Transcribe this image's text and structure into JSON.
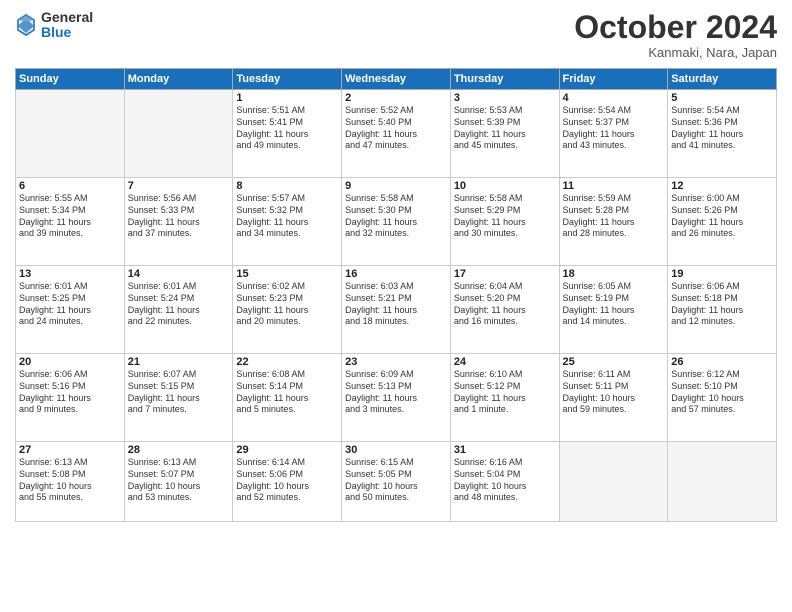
{
  "logo": {
    "general": "General",
    "blue": "Blue"
  },
  "title": "October 2024",
  "location": "Kanmaki, Nara, Japan",
  "weekdays": [
    "Sunday",
    "Monday",
    "Tuesday",
    "Wednesday",
    "Thursday",
    "Friday",
    "Saturday"
  ],
  "cells": [
    {
      "day": "",
      "empty": true
    },
    {
      "day": "",
      "empty": true
    },
    {
      "day": "1",
      "lines": [
        "Sunrise: 5:51 AM",
        "Sunset: 5:41 PM",
        "Daylight: 11 hours",
        "and 49 minutes."
      ]
    },
    {
      "day": "2",
      "lines": [
        "Sunrise: 5:52 AM",
        "Sunset: 5:40 PM",
        "Daylight: 11 hours",
        "and 47 minutes."
      ]
    },
    {
      "day": "3",
      "lines": [
        "Sunrise: 5:53 AM",
        "Sunset: 5:39 PM",
        "Daylight: 11 hours",
        "and 45 minutes."
      ]
    },
    {
      "day": "4",
      "lines": [
        "Sunrise: 5:54 AM",
        "Sunset: 5:37 PM",
        "Daylight: 11 hours",
        "and 43 minutes."
      ]
    },
    {
      "day": "5",
      "lines": [
        "Sunrise: 5:54 AM",
        "Sunset: 5:36 PM",
        "Daylight: 11 hours",
        "and 41 minutes."
      ]
    },
    {
      "day": "6",
      "lines": [
        "Sunrise: 5:55 AM",
        "Sunset: 5:34 PM",
        "Daylight: 11 hours",
        "and 39 minutes."
      ]
    },
    {
      "day": "7",
      "lines": [
        "Sunrise: 5:56 AM",
        "Sunset: 5:33 PM",
        "Daylight: 11 hours",
        "and 37 minutes."
      ]
    },
    {
      "day": "8",
      "lines": [
        "Sunrise: 5:57 AM",
        "Sunset: 5:32 PM",
        "Daylight: 11 hours",
        "and 34 minutes."
      ]
    },
    {
      "day": "9",
      "lines": [
        "Sunrise: 5:58 AM",
        "Sunset: 5:30 PM",
        "Daylight: 11 hours",
        "and 32 minutes."
      ]
    },
    {
      "day": "10",
      "lines": [
        "Sunrise: 5:58 AM",
        "Sunset: 5:29 PM",
        "Daylight: 11 hours",
        "and 30 minutes."
      ]
    },
    {
      "day": "11",
      "lines": [
        "Sunrise: 5:59 AM",
        "Sunset: 5:28 PM",
        "Daylight: 11 hours",
        "and 28 minutes."
      ]
    },
    {
      "day": "12",
      "lines": [
        "Sunrise: 6:00 AM",
        "Sunset: 5:26 PM",
        "Daylight: 11 hours",
        "and 26 minutes."
      ]
    },
    {
      "day": "13",
      "lines": [
        "Sunrise: 6:01 AM",
        "Sunset: 5:25 PM",
        "Daylight: 11 hours",
        "and 24 minutes."
      ]
    },
    {
      "day": "14",
      "lines": [
        "Sunrise: 6:01 AM",
        "Sunset: 5:24 PM",
        "Daylight: 11 hours",
        "and 22 minutes."
      ]
    },
    {
      "day": "15",
      "lines": [
        "Sunrise: 6:02 AM",
        "Sunset: 5:23 PM",
        "Daylight: 11 hours",
        "and 20 minutes."
      ]
    },
    {
      "day": "16",
      "lines": [
        "Sunrise: 6:03 AM",
        "Sunset: 5:21 PM",
        "Daylight: 11 hours",
        "and 18 minutes."
      ]
    },
    {
      "day": "17",
      "lines": [
        "Sunrise: 6:04 AM",
        "Sunset: 5:20 PM",
        "Daylight: 11 hours",
        "and 16 minutes."
      ]
    },
    {
      "day": "18",
      "lines": [
        "Sunrise: 6:05 AM",
        "Sunset: 5:19 PM",
        "Daylight: 11 hours",
        "and 14 minutes."
      ]
    },
    {
      "day": "19",
      "lines": [
        "Sunrise: 6:06 AM",
        "Sunset: 5:18 PM",
        "Daylight: 11 hours",
        "and 12 minutes."
      ]
    },
    {
      "day": "20",
      "lines": [
        "Sunrise: 6:06 AM",
        "Sunset: 5:16 PM",
        "Daylight: 11 hours",
        "and 9 minutes."
      ]
    },
    {
      "day": "21",
      "lines": [
        "Sunrise: 6:07 AM",
        "Sunset: 5:15 PM",
        "Daylight: 11 hours",
        "and 7 minutes."
      ]
    },
    {
      "day": "22",
      "lines": [
        "Sunrise: 6:08 AM",
        "Sunset: 5:14 PM",
        "Daylight: 11 hours",
        "and 5 minutes."
      ]
    },
    {
      "day": "23",
      "lines": [
        "Sunrise: 6:09 AM",
        "Sunset: 5:13 PM",
        "Daylight: 11 hours",
        "and 3 minutes."
      ]
    },
    {
      "day": "24",
      "lines": [
        "Sunrise: 6:10 AM",
        "Sunset: 5:12 PM",
        "Daylight: 11 hours",
        "and 1 minute."
      ]
    },
    {
      "day": "25",
      "lines": [
        "Sunrise: 6:11 AM",
        "Sunset: 5:11 PM",
        "Daylight: 10 hours",
        "and 59 minutes."
      ]
    },
    {
      "day": "26",
      "lines": [
        "Sunrise: 6:12 AM",
        "Sunset: 5:10 PM",
        "Daylight: 10 hours",
        "and 57 minutes."
      ]
    },
    {
      "day": "27",
      "lines": [
        "Sunrise: 6:13 AM",
        "Sunset: 5:08 PM",
        "Daylight: 10 hours",
        "and 55 minutes."
      ]
    },
    {
      "day": "28",
      "lines": [
        "Sunrise: 6:13 AM",
        "Sunset: 5:07 PM",
        "Daylight: 10 hours",
        "and 53 minutes."
      ]
    },
    {
      "day": "29",
      "lines": [
        "Sunrise: 6:14 AM",
        "Sunset: 5:06 PM",
        "Daylight: 10 hours",
        "and 52 minutes."
      ]
    },
    {
      "day": "30",
      "lines": [
        "Sunrise: 6:15 AM",
        "Sunset: 5:05 PM",
        "Daylight: 10 hours",
        "and 50 minutes."
      ]
    },
    {
      "day": "31",
      "lines": [
        "Sunrise: 6:16 AM",
        "Sunset: 5:04 PM",
        "Daylight: 10 hours",
        "and 48 minutes."
      ]
    },
    {
      "day": "",
      "empty": true
    },
    {
      "day": "",
      "empty": true
    }
  ]
}
